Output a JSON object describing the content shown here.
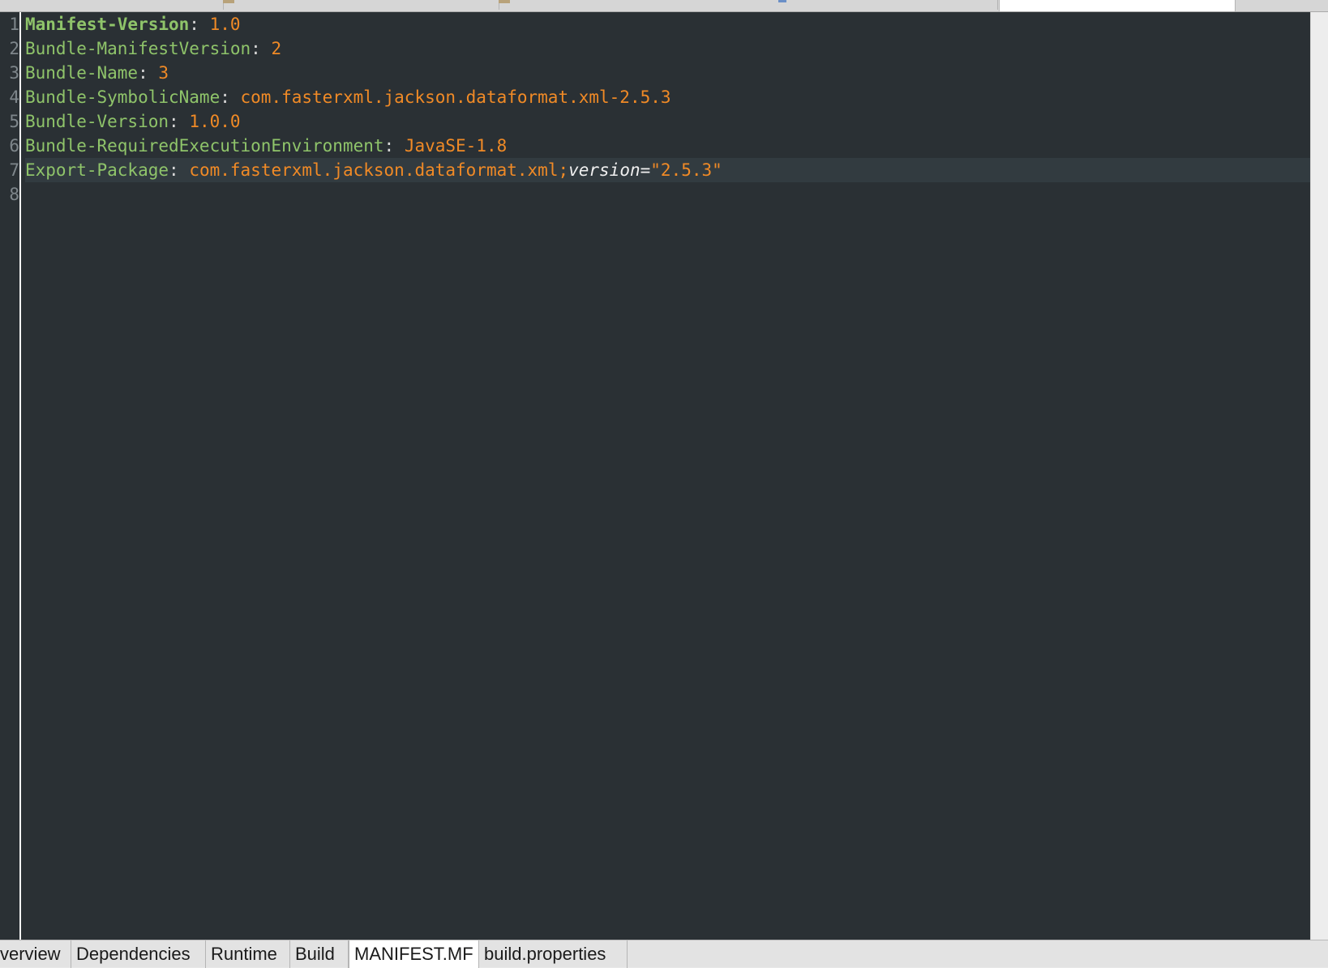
{
  "editor": {
    "lines": [
      {
        "num": "1",
        "key": "Manifest-Version",
        "sep": ": ",
        "value": "1.0"
      },
      {
        "num": "2",
        "key": "Bundle-ManifestVersion",
        "sep": ": ",
        "value": "2"
      },
      {
        "num": "3",
        "key": "Bundle-Name",
        "sep": ": ",
        "value": "3"
      },
      {
        "num": "4",
        "key": "Bundle-SymbolicName",
        "sep": ": ",
        "value": "com.fasterxml.jackson.dataformat.xml-2.5.3"
      },
      {
        "num": "5",
        "key": "Bundle-Version",
        "sep": ": ",
        "value": "1.0.0"
      },
      {
        "num": "6",
        "key": "Bundle-RequiredExecutionEnvironment",
        "sep": ": ",
        "value": "JavaSE-1.8"
      },
      {
        "num": "7",
        "key": "Export-Package",
        "sep": ": ",
        "value": "com.fasterxml.jackson.dataformat.xml;",
        "attr": "version",
        "eq": "=",
        "attr_value": "\"2.5.3\""
      },
      {
        "num": "8"
      }
    ]
  },
  "bottom_tabs": [
    {
      "label": "verview"
    },
    {
      "label": "Dependencies"
    },
    {
      "label": "Runtime"
    },
    {
      "label": "Build"
    },
    {
      "label": "MANIFEST.MF"
    },
    {
      "label": "build.properties"
    }
  ],
  "colors": {
    "editor_bg": "#2a3034",
    "key": "#8fc46a",
    "value": "#f08a26",
    "current_line": "#323b40"
  }
}
